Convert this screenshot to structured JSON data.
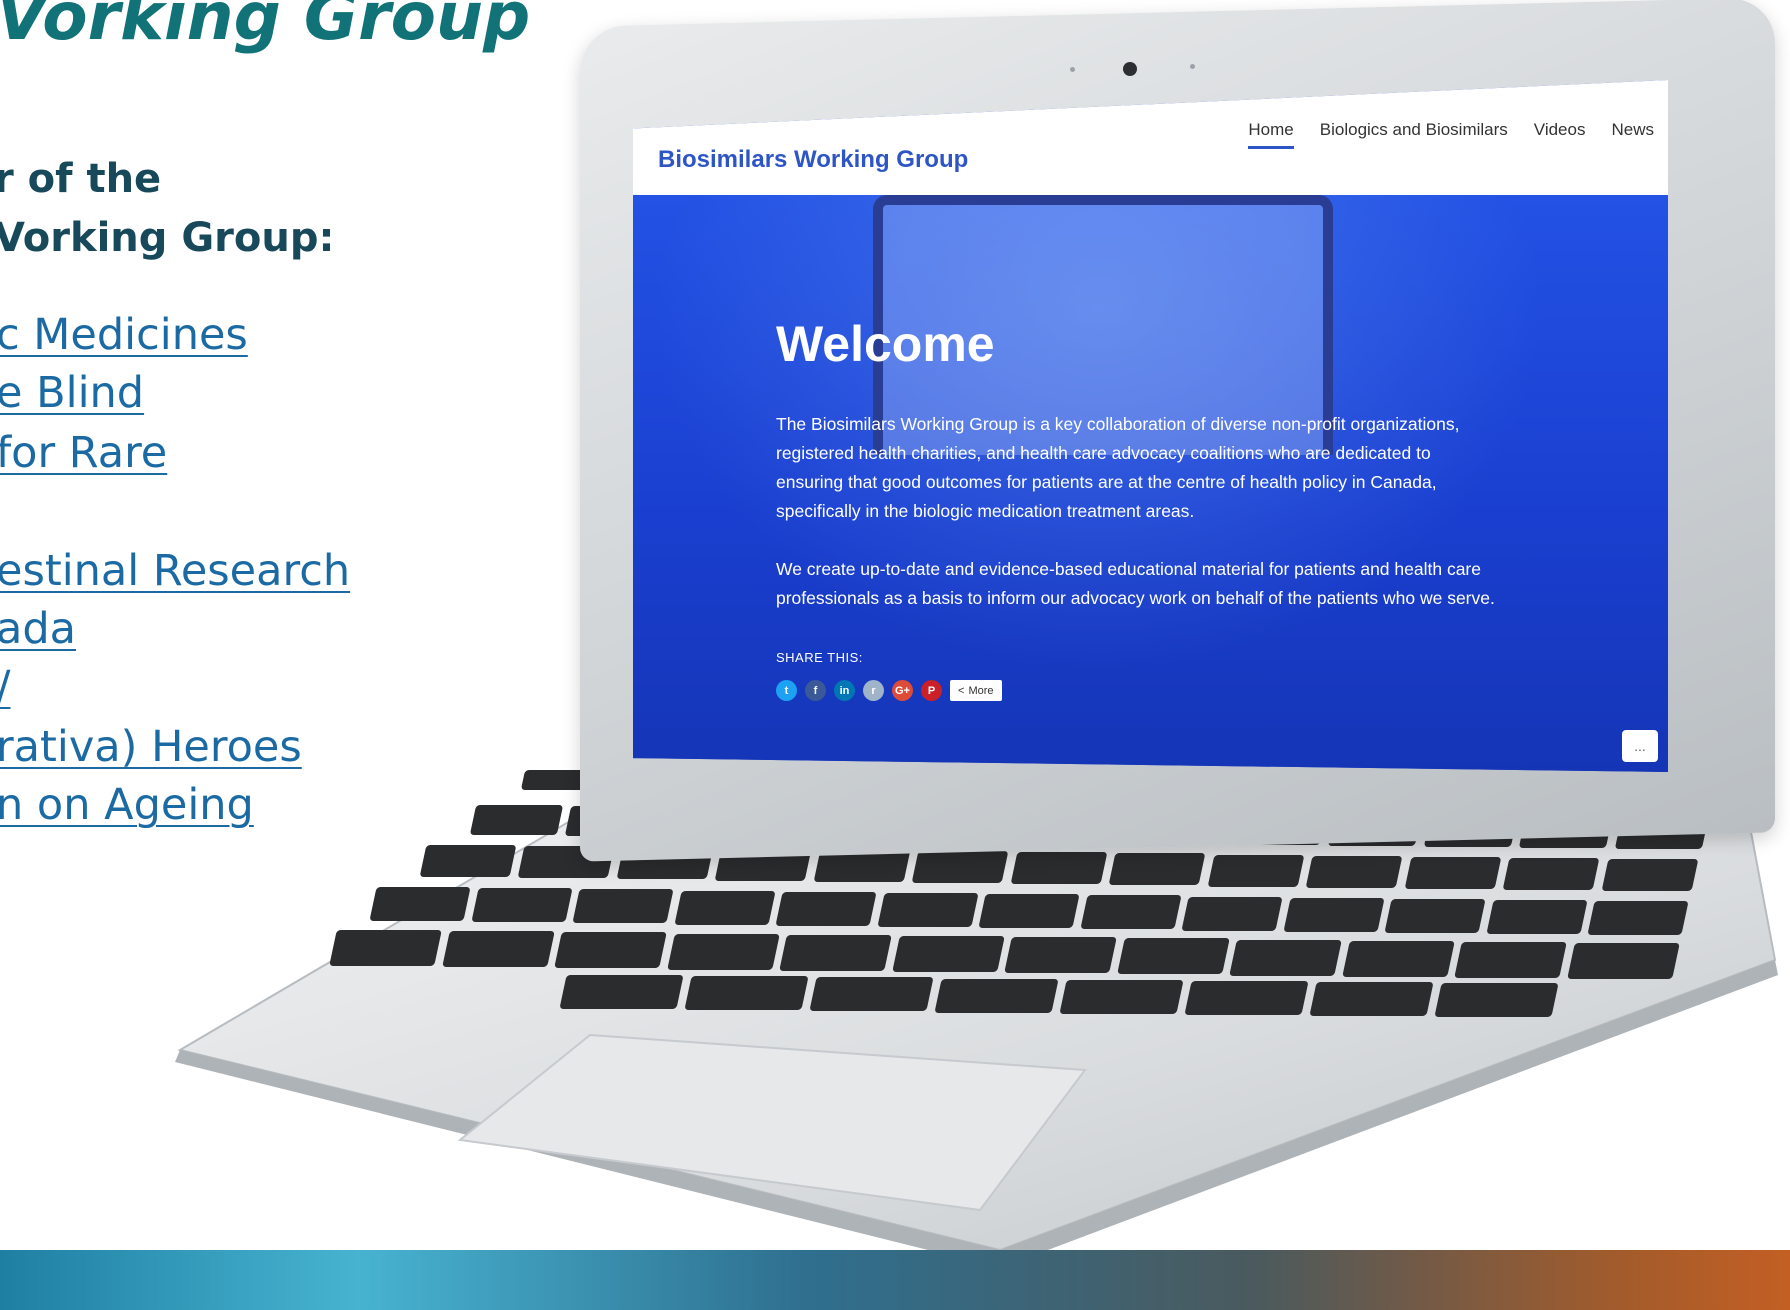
{
  "slide": {
    "title": "Vorking Group",
    "subheading_lines": [
      "r of the",
      "Vorking Group:"
    ],
    "member_links": [
      "c Medicines ",
      "e Blind",
      "for Rare",
      "estinal Research",
      "ada",
      "/",
      "rativa) Heroes",
      "n on Ageing"
    ]
  },
  "website": {
    "logo": "Biosimilars Working Group",
    "nav": [
      "Home",
      "Biologics and Biosimilars",
      "Videos",
      "News"
    ],
    "active_nav": "Home",
    "hero": {
      "heading": "Welcome",
      "paragraph_1": "The Biosimilars Working Group is a key collaboration of diverse non-profit organizations, registered health charities, and health care advocacy coalitions who are dedicated to ensuring that good outcomes for patients are at the centre of health policy in Canada, specifically in the biologic medication treatment areas.",
      "paragraph_2": "We create up-to-date and evidence-based educational material for patients and health care professionals as a basis to inform our advocacy work on behalf of the patients who we serve.",
      "share_label": "SHARE THIS:",
      "share_icons": [
        {
          "name": "twitter-icon",
          "glyph": "t",
          "color": "#1da1f2"
        },
        {
          "name": "facebook-icon",
          "glyph": "f",
          "color": "#3b5998"
        },
        {
          "name": "linkedin-icon",
          "glyph": "in",
          "color": "#0077b5"
        },
        {
          "name": "reddit-icon",
          "glyph": "r",
          "color": "#9fb4c8"
        },
        {
          "name": "google-plus-icon",
          "glyph": "G+",
          "color": "#dd4b39"
        },
        {
          "name": "pinterest-icon",
          "glyph": "P",
          "color": "#cb2027"
        }
      ],
      "more_label": "More",
      "dots_label": "..."
    }
  },
  "colors": {
    "title_teal": "#117377",
    "link_blue": "#1c6aa3",
    "hero_blue": "#1942d9"
  }
}
